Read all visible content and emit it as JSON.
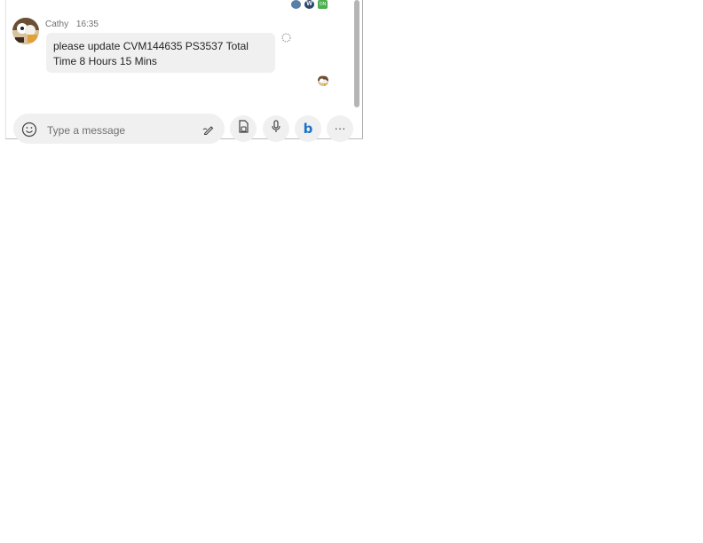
{
  "conversation": {
    "read_receipts": [
      "avatar",
      "avatar",
      "avatar"
    ],
    "receipt_letters": {
      "second": "W",
      "third": "ON"
    },
    "messages": [
      {
        "sender": "Cathy",
        "time": "16:35",
        "text_line1": "please update CVM144635  PS3537   Total",
        "text_line2": "Time 8 Hours 15 Mins"
      }
    ]
  },
  "composer": {
    "placeholder": "Type a message"
  },
  "icons": {
    "emoji": "emoji-icon",
    "format": "format-pen-icon",
    "attach": "attach-file-icon",
    "mic": "microphone-icon",
    "bing": "bing-icon",
    "more": "more-horizontal-icon",
    "react": "reaction-smile-icon"
  },
  "labels": {
    "more": "···",
    "bing": "b"
  },
  "colors": {
    "bubble": "#f0f0f0",
    "accent_bing": "#1a73c8",
    "meta_text": "#707070"
  }
}
